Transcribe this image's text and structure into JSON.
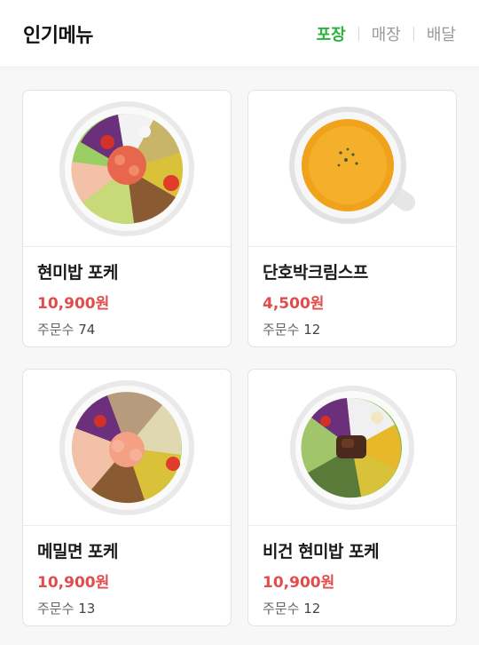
{
  "header": {
    "title": "인기메뉴",
    "tabs": [
      {
        "label": "포장",
        "active": true
      },
      {
        "label": "매장",
        "active": false
      },
      {
        "label": "배달",
        "active": false
      }
    ]
  },
  "colors": {
    "accent": "#2bb23f",
    "price": "#e24c4c"
  },
  "menu": [
    {
      "name": "현미밥 포케",
      "price": "10,900원",
      "orders_label": "주문수",
      "orders": "74",
      "image": "poke-bowl"
    },
    {
      "name": "단호박크림스프",
      "price": "4,500원",
      "orders_label": "주문수",
      "orders": "12",
      "image": "pumpkin-soup-cup"
    },
    {
      "name": "메밀면 포케",
      "price": "10,900원",
      "orders_label": "주문수",
      "orders": "13",
      "image": "buckwheat-poke-bowl"
    },
    {
      "name": "비건 현미밥 포케",
      "price": "10,900원",
      "orders_label": "주문수",
      "orders": "12",
      "image": "vegan-poke-bowl"
    }
  ]
}
